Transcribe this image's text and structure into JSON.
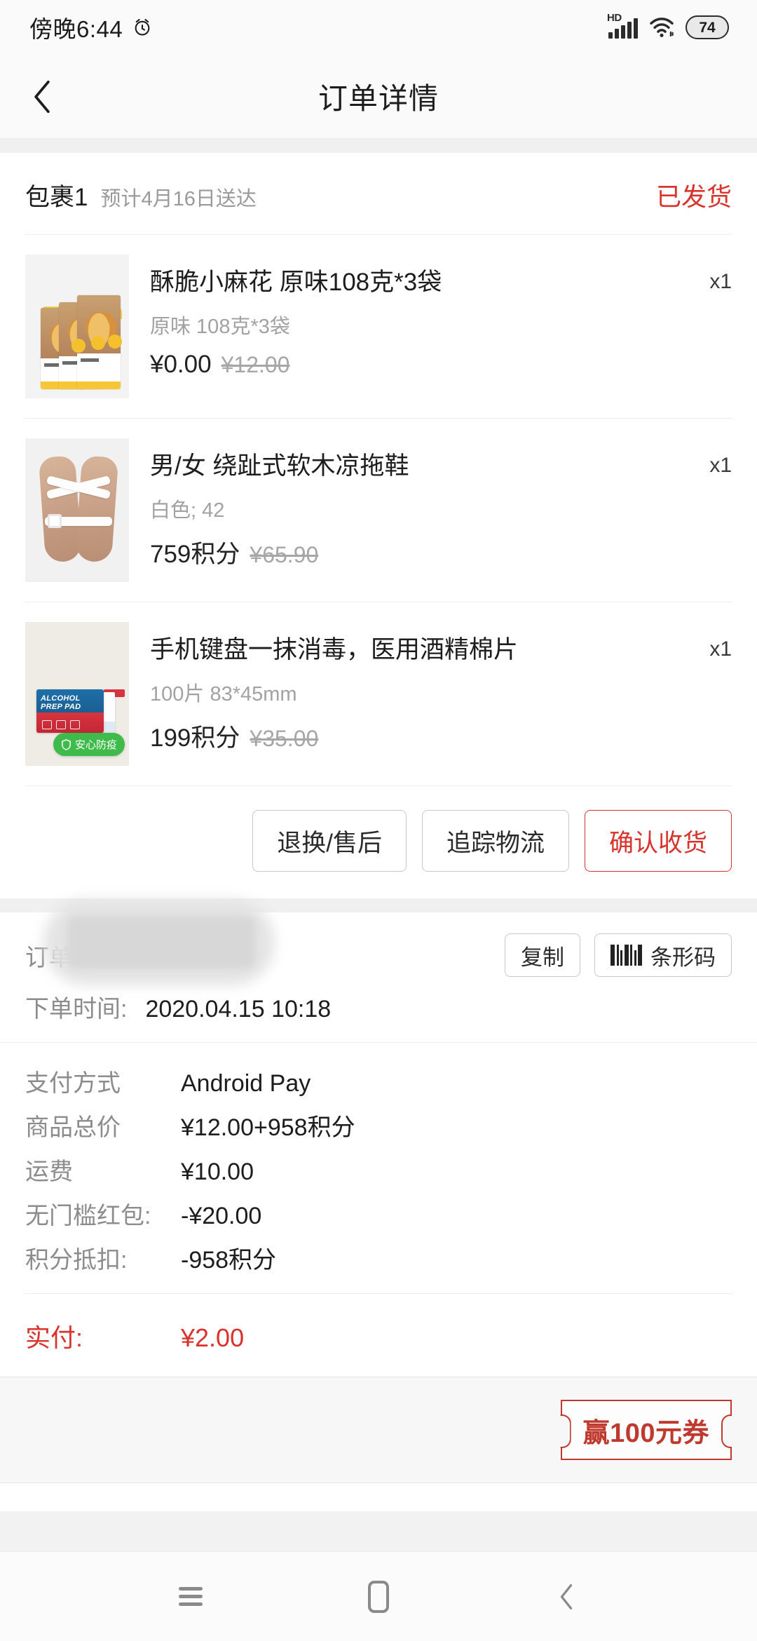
{
  "status_bar": {
    "time": "傍晚6:44",
    "alarm_icon": "alarm-clock-icon",
    "network_label": "HD",
    "signal_icon": "signal-bars-icon",
    "wifi_icon": "wifi-icon",
    "battery_level": "74"
  },
  "header": {
    "back_icon": "chevron-left-icon",
    "title": "订单详情"
  },
  "package": {
    "name": "包裹1",
    "eta": "预计4月16日送达",
    "status": "已发货",
    "status_color": "#d9332e"
  },
  "products": [
    {
      "title": "酥脆小麻花 原味108克*3袋",
      "spec": "原味 108克*3袋",
      "price": "¥0.00",
      "original_price": "¥12.00",
      "qty": "x1",
      "image_name": "snack-twist-pack-image"
    },
    {
      "title": "男/女 绕趾式软木凉拖鞋",
      "spec": "白色; 42",
      "price": "759积分",
      "original_price": "¥65.90",
      "qty": "x1",
      "image_name": "cork-sandals-image"
    },
    {
      "title": "手机键盘一抹消毒，医用酒精棉片",
      "spec": "100片 83*45mm",
      "price": "199积分",
      "original_price": "¥35.00",
      "qty": "x1",
      "image_name": "alcohol-prep-pad-image",
      "badge": "安心防疫",
      "badge_color": "#3fbb4b",
      "pad_brand_line1": "ALCOHOL",
      "pad_brand_line2": "PREP PAD"
    }
  ],
  "actions": {
    "refund": "退换/售后",
    "track": "追踪物流",
    "confirm": "确认收货"
  },
  "order_info": {
    "order_no_label": "订单",
    "order_no_value": "",
    "copy_button": "复制",
    "barcode_button": "条形码",
    "barcode_icon": "barcode-icon",
    "time_label": "下单时间:",
    "time_value": "2020.04.15 10:18"
  },
  "payment": {
    "rows": [
      {
        "label": "支付方式",
        "value": "Android Pay"
      },
      {
        "label": "商品总价",
        "value": "¥12.00+958积分"
      },
      {
        "label": "运费",
        "value": "¥10.00"
      },
      {
        "label": "无门槛红包:",
        "value": "-¥20.00"
      },
      {
        "label": "积分抵扣:",
        "value": "-958积分"
      }
    ],
    "total_label": "实付:",
    "total_value": "¥2.00",
    "total_color": "#d9332e"
  },
  "footer": {
    "coupon_text": "赢100元券",
    "coupon_color": "#c0392f"
  },
  "nav_bar": {
    "menu_icon": "menu-icon",
    "home_icon": "home-icon",
    "back_icon": "back-chevron-icon"
  }
}
